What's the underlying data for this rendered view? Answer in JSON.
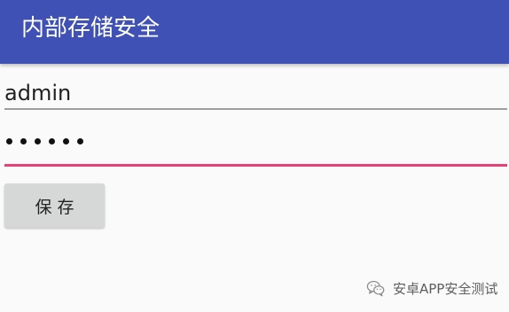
{
  "app_bar": {
    "title": "内部存储安全",
    "background": "#3f51b5"
  },
  "form": {
    "username_value": "admin",
    "password_mask_count": 6,
    "password_underline_color": "#e8417a",
    "save_button_label": "保存"
  },
  "watermark": {
    "text": "安卓APP安全测试",
    "icon": "wechat-icon"
  }
}
